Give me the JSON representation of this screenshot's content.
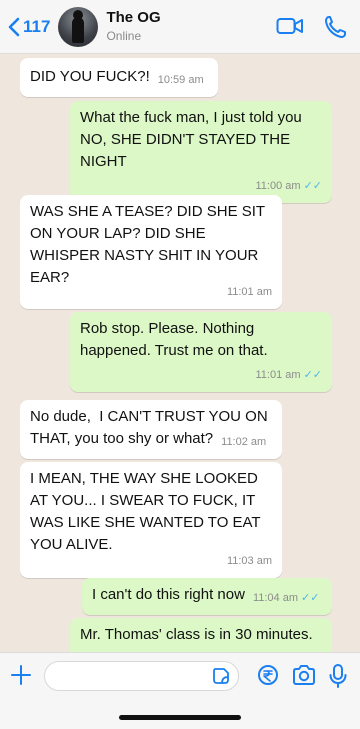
{
  "header": {
    "back_count": "117",
    "contact_name": "The OG",
    "status": "Online"
  },
  "messages": [
    {
      "dir": "in",
      "text": "DID YOU FUCK?!",
      "time": "10:59 am"
    },
    {
      "dir": "out",
      "text": "What the fuck man, I just told you NO, SHE DIDN'T STAYED THE NIGHT",
      "time": "11:00 am",
      "read": true
    },
    {
      "dir": "in",
      "text": "WAS SHE A TEASE? DID SHE SIT ON YOUR LAP? DID SHE WHISPER NASTY SHIT IN YOUR EAR?",
      "time": "11:01 am"
    },
    {
      "dir": "out",
      "text": "Rob stop. Please. Nothing happened. Trust me on that.",
      "time": "11:01 am",
      "read": true
    },
    {
      "dir": "in",
      "text": "No dude,  I CAN'T TRUST YOU ON THAT, you too shy or what?",
      "time": "11:02 am"
    },
    {
      "dir": "in",
      "text": "I MEAN, THE WAY SHE LOOKED AT YOU... I SWEAR TO FUCK, IT WAS LIKE SHE WANTED TO EAT YOU ALIVE.",
      "time": "11:03 am"
    },
    {
      "dir": "out",
      "text": "I can't do this right now",
      "time": "11:04 am",
      "read": true
    },
    {
      "dir": "out",
      "text": "Mr. Thomas' class is in 30 minutes.",
      "time": ""
    }
  ],
  "composer": {
    "input_value": "",
    "placeholder": ""
  },
  "colors": {
    "accent": "#1a7ff0",
    "outgoing_bubble": "#dcf8c6",
    "incoming_bubble": "#ffffff",
    "chat_background": "#efe7de",
    "read_ticks": "#4fb6ec"
  },
  "icons": [
    "chevron-left-icon",
    "video-call-icon",
    "phone-icon",
    "plus-icon",
    "sticker-icon",
    "payment-icon",
    "camera-icon",
    "microphone-icon"
  ]
}
